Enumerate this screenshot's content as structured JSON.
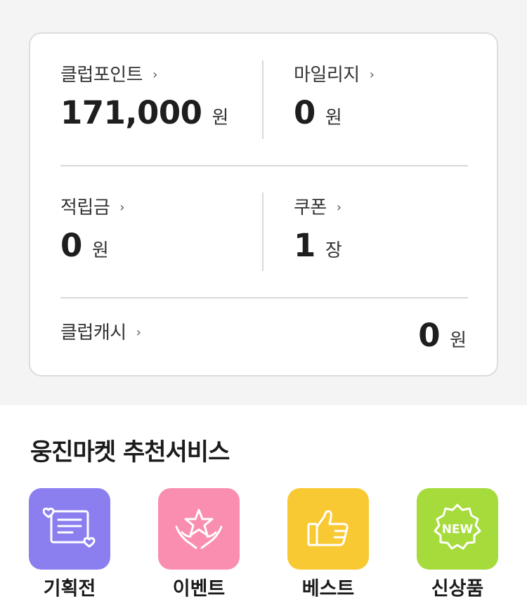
{
  "points": {
    "club_point": {
      "label": "클럽포인트",
      "chevron": "›",
      "value": "171,000",
      "unit": "원"
    },
    "mileage": {
      "label": "마일리지",
      "chevron": "›",
      "value": "0",
      "unit": "원"
    },
    "reserve": {
      "label": "적립금",
      "chevron": "›",
      "value": "0",
      "unit": "원"
    },
    "coupon": {
      "label": "쿠폰",
      "chevron": "›",
      "value": "1",
      "unit": "장"
    },
    "club_cash": {
      "label": "클럽캐시",
      "chevron": "›",
      "value": "0",
      "unit": "원"
    }
  },
  "recommend": {
    "title": "웅진마켓 추천서비스",
    "items": [
      {
        "label": "기획전",
        "icon": "exhibition-card-icon",
        "color": "#8b7ff0"
      },
      {
        "label": "이벤트",
        "icon": "star-hands-icon",
        "color": "#f98eb0"
      },
      {
        "label": "베스트",
        "icon": "thumbs-up-icon",
        "color": "#f9c933"
      },
      {
        "label": "신상품",
        "icon": "new-badge-icon",
        "color": "#a6db3c",
        "badge_text": "NEW"
      }
    ]
  }
}
